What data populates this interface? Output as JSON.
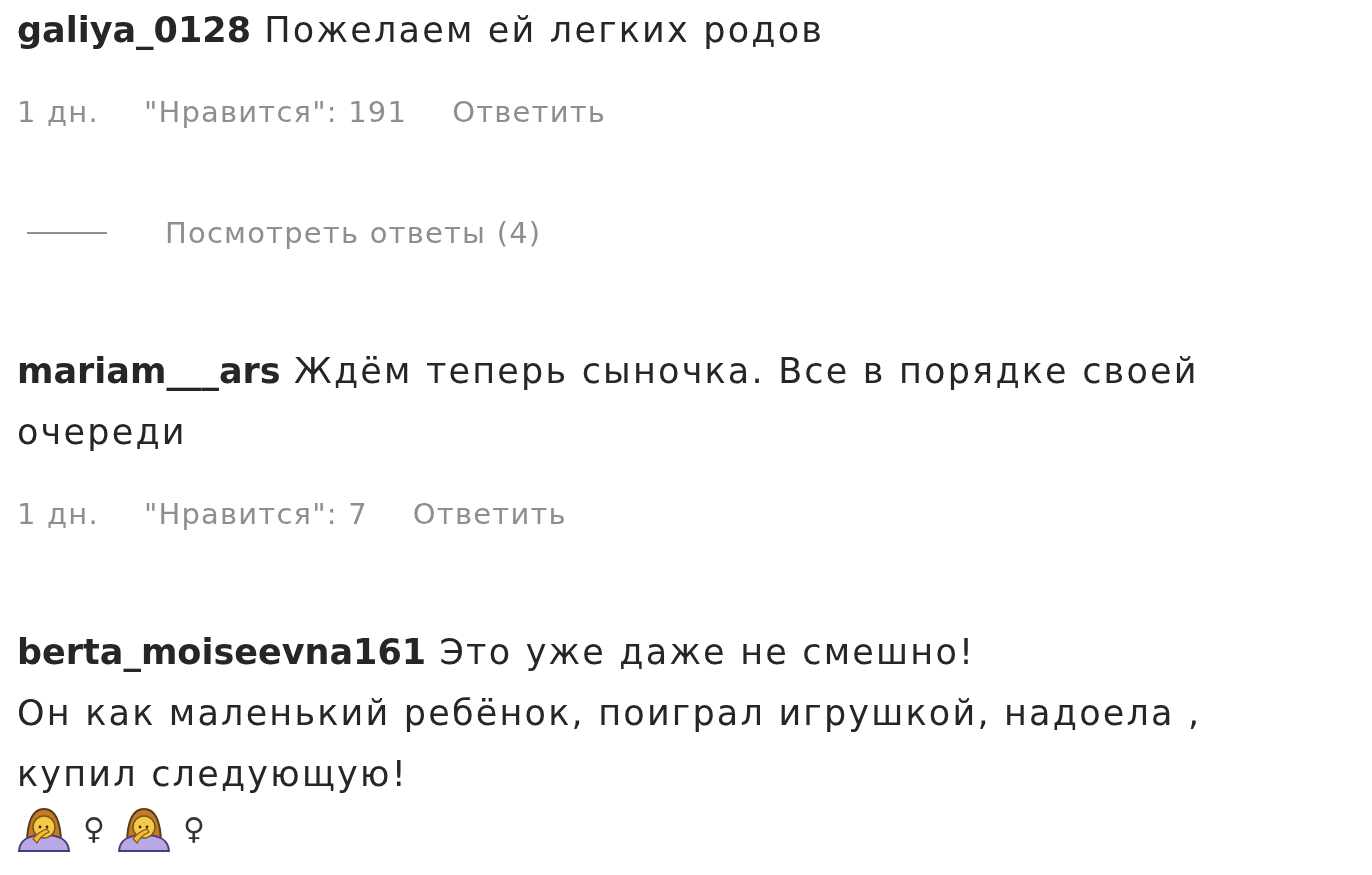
{
  "comments": [
    {
      "username": "galiya_0128",
      "text": "Пожелаем ей легких родов",
      "time": "1 дн.",
      "likes": "\"Нравится\": 191",
      "reply": "Ответить",
      "view_replies": "Посмотреть ответы (4)"
    },
    {
      "username": "mariam___ars",
      "text": "Ждём теперь сыночка. Все в порядке своей очереди",
      "time": "1 дн.",
      "likes": "\"Нравится\": 7",
      "reply": "Ответить"
    },
    {
      "username": "berta_moiseevna161",
      "text": "Это уже даже не смешно!\nОн как маленький ребёнок, поиграл игрушкой, надоела , купил следующую!",
      "emoji": [
        {
          "kind": "person"
        },
        {
          "kind": "symbol",
          "text": "♀"
        },
        {
          "kind": "person"
        },
        {
          "kind": "symbol",
          "text": "♀"
        }
      ]
    }
  ]
}
